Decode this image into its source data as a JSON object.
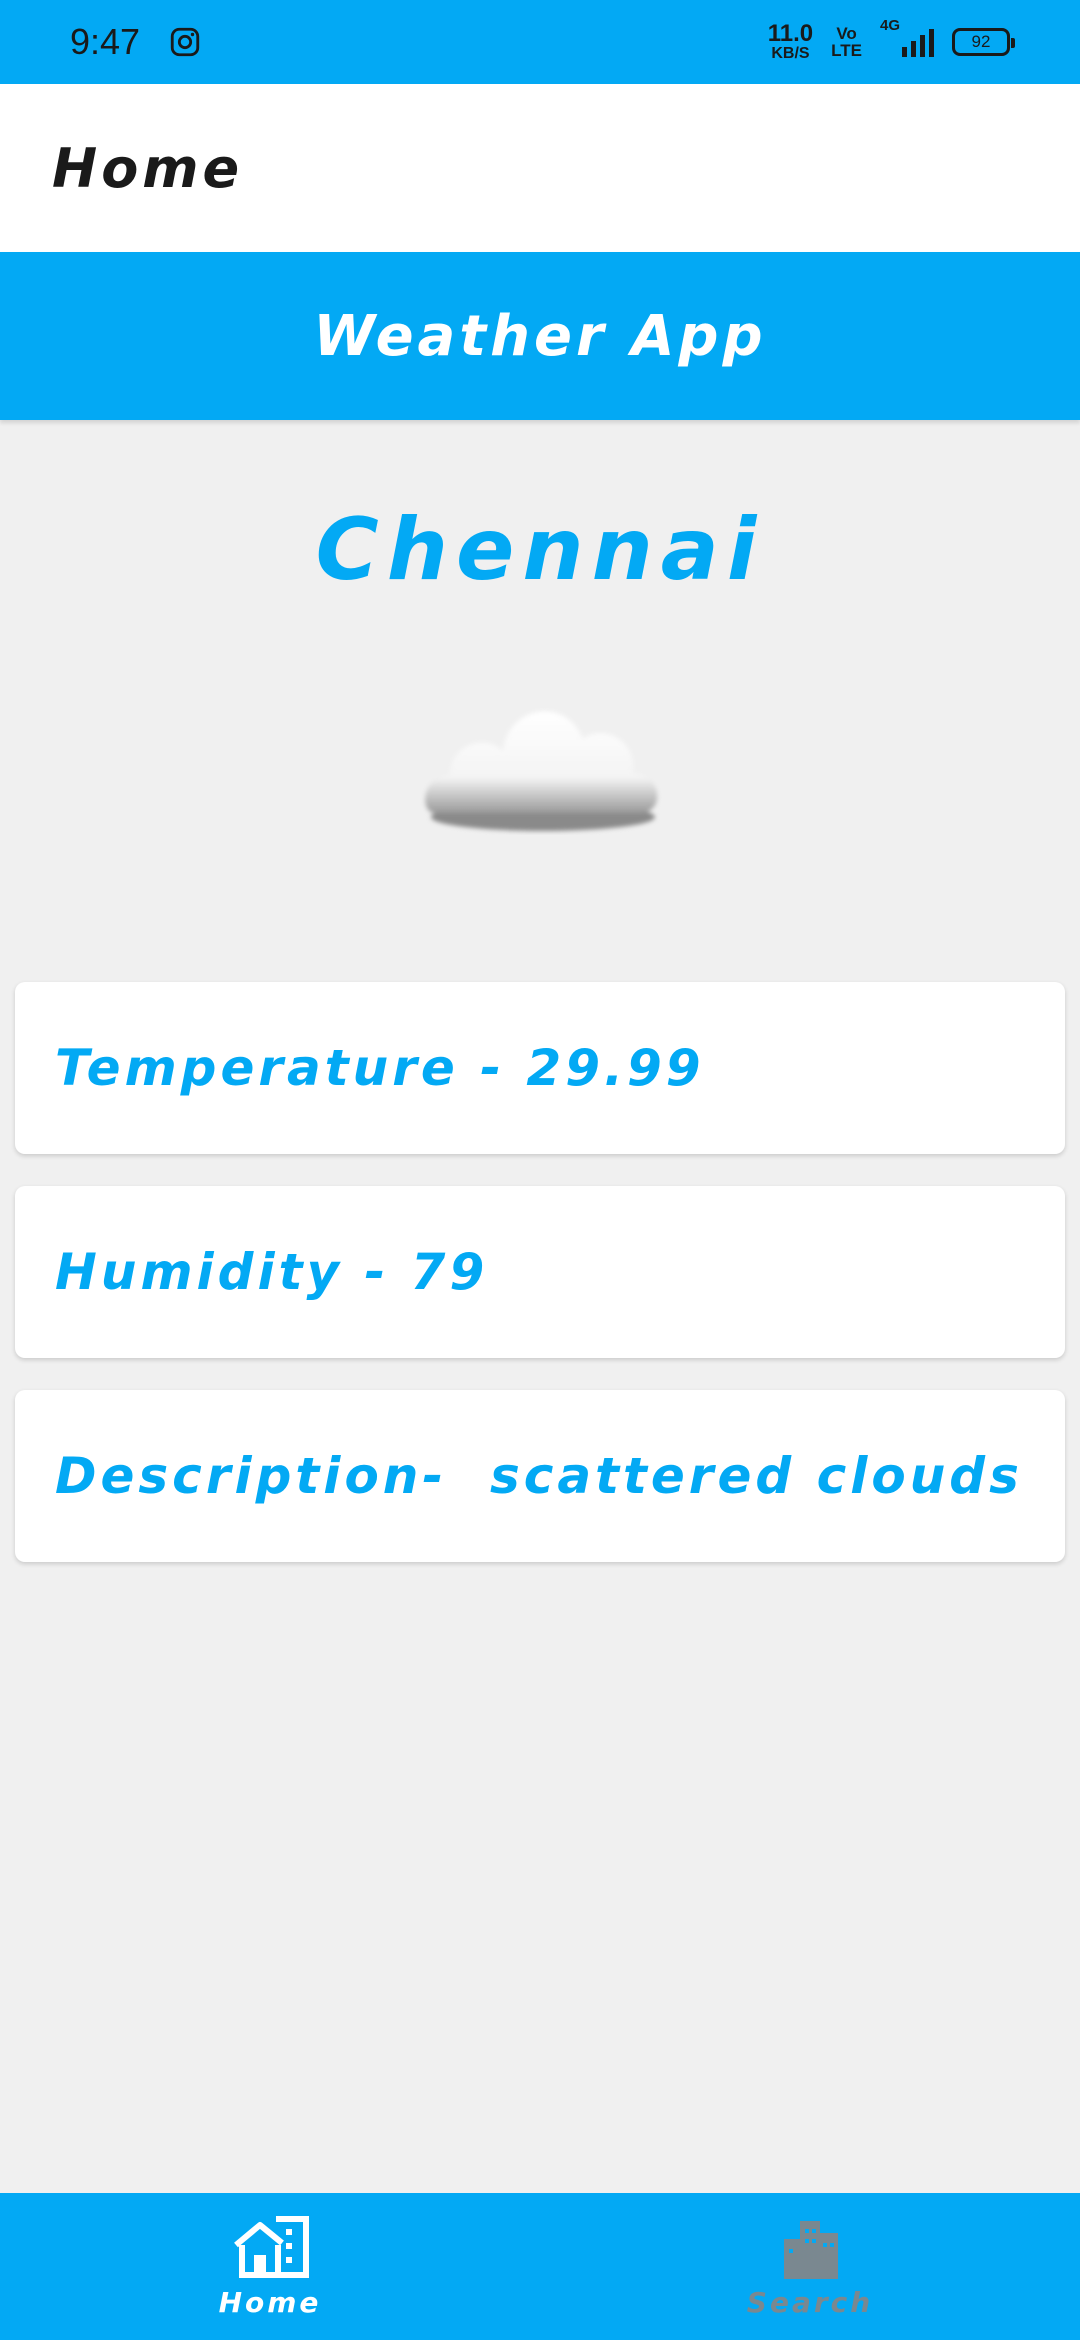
{
  "status_bar": {
    "time": "9:47",
    "net_speed_value": "11.0",
    "net_speed_unit": "KB/S",
    "volte_top": "Vo",
    "volte_bottom": "LTE",
    "network": "4G",
    "battery": "92",
    "icons": [
      "instagram-icon",
      "signal-icon",
      "battery-icon"
    ]
  },
  "app_bar": {
    "title": "Home"
  },
  "banner": {
    "title": "Weather App"
  },
  "weather": {
    "city": "Chennai",
    "icon": "cloud-icon",
    "temperature_text": "Temperature - 29.99",
    "humidity_text": "Humidity - 79",
    "description_text": "Description-  scattered clouds"
  },
  "bottom_nav": {
    "items": [
      {
        "label": "Home",
        "icon": "home-building-icon",
        "active": true
      },
      {
        "label": "Search",
        "icon": "city-buildings-icon",
        "active": false
      }
    ]
  },
  "colors": {
    "primary": "#03a9f4",
    "background": "#f0f0f0",
    "card": "#ffffff",
    "inactive_nav": "#7a8890"
  }
}
